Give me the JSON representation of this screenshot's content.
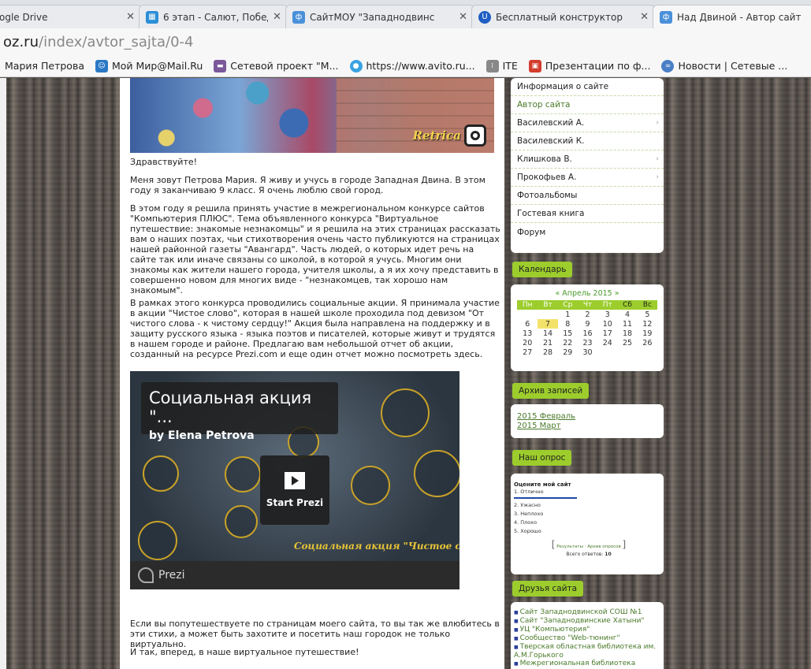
{
  "tabs": [
    {
      "label": "ogle Drive",
      "icon": "google-drive-icon",
      "color": "#d9d9d9"
    },
    {
      "label": "6 этап - Салют, Победа!",
      "icon": "calendar-icon",
      "color": "#2a8ed6"
    },
    {
      "label": "СайтМОУ \"Западнодвинс",
      "icon": "ucoz-icon",
      "color": "#4a90d9"
    },
    {
      "label": "Бесплатный конструктор",
      "icon": "ucoz-u-icon",
      "color": "#1f5fc4"
    },
    {
      "label": "Над Двиной - Автор сайт",
      "icon": "ucoz-icon",
      "color": "#4a90d9"
    }
  ],
  "address": {
    "host": "oz.ru",
    "path": "/index/avtor_sajta/0-4"
  },
  "bookmarks": [
    {
      "label": "Мария Петрова",
      "icon": "",
      "color": "#ffffff"
    },
    {
      "label": "Мой Мир@Mail.Ru",
      "icon": "mailru-icon",
      "color": "#2b78c5"
    },
    {
      "label": "Сетевой проект \"М...",
      "icon": "computer-icon",
      "color": "#7a5a9a"
    },
    {
      "label": "https://www.avito.ru...",
      "icon": "avito-icon",
      "color": "#3aa2e0"
    },
    {
      "label": "ITE",
      "icon": "ite-icon",
      "color": "#888888"
    },
    {
      "label": "Презентации по ф...",
      "icon": "presentation-icon",
      "color": "#d33d2e"
    },
    {
      "label": "Новости | Сетевые ...",
      "icon": "link-icon",
      "color": "#4a7fc6"
    }
  ],
  "content": {
    "greeting": "Здравствуйте!",
    "p1": "Меня зовут Петрова Мария. Я живу и учусь в городе Западная Двина. В этом году я заканчиваю 9 класс. Я очень люблю свой город.",
    "p2": "В этом году я решила принять участие в межрегиональном конкурсе сайтов \"Компьютерия ПЛЮС\". Тема объявленного конкурса \"Виртуальное путешествие: знакомые незнакомцы\" и я решила на этих страницах рассказать вам о наших поэтах, чьи стихотворения очень часто публикуются на страницах нашей районной газеты \"Авангард\". Часть людей, о которых идет речь на сайте так или иначе связаны со школой, в которой я учусь. Многим они знакомы как жители нашего города, учителя школы, а я их хочу представить в совершенно новом для многих виде - \"незнакомцев, так хорошо нам знакомым\".",
    "p3": "В рамках этого конкурса проводились социальные акции. Я принимала участие в акции \"Чистое слово\", которая в нашей школе проходила под девизом \"От чистого слова - к чистому сердцу!\" Акция была направлена на поддержку и в защиту русского языка - языка поэтов и писателей, которые живут и трудятся в нашем городе и районе. Предлагаю вам небольшой отчет об акции, созданный на ресурсе Prezi.com и еще один отчет можно посмотреть здесь.",
    "p4": "Если вы попутешествуете по страницам моего сайта, то вы так же влюбитесь в эти стихи, а может быть захотите и посетить наш городок не только виртуально.",
    "p5": "И так, вперед, в наше виртуальное путешествие!"
  },
  "prezi": {
    "title": "Социальная акция \"...",
    "author": "by Elena Petrova",
    "start": "Start Prezi",
    "caption": "Социальная акция \"Чистое сл",
    "brand": "Prezi"
  },
  "banner": {
    "logo_text": "Retrica"
  },
  "sidebar": {
    "menu": [
      {
        "label": "Информация о сайте",
        "arrow": false,
        "link": false
      },
      {
        "label": "Автор сайта",
        "arrow": false,
        "link": true
      },
      {
        "label": "Василевский А.",
        "arrow": true,
        "link": false
      },
      {
        "label": "Василевский К.",
        "arrow": false,
        "link": false
      },
      {
        "label": "Клишкова В.",
        "arrow": true,
        "link": false
      },
      {
        "label": "Прокофьев А.",
        "arrow": true,
        "link": false
      },
      {
        "label": "Фотоальбомы",
        "arrow": false,
        "link": false
      },
      {
        "label": "Гостевая книга",
        "arrow": false,
        "link": false
      },
      {
        "label": "Форум",
        "arrow": false,
        "link": false
      }
    ],
    "calendar_title": "Календарь",
    "calendar": {
      "month": "«   Апрель 2015   »",
      "days": [
        "Пн",
        "Вт",
        "Ср",
        "Чт",
        "Пт",
        "Сб",
        "Вс"
      ],
      "weeks": [
        [
          "",
          "",
          "1",
          "2",
          "3",
          "4",
          "5"
        ],
        [
          "6",
          "7",
          "8",
          "9",
          "10",
          "11",
          "12"
        ],
        [
          "13",
          "14",
          "15",
          "16",
          "17",
          "18",
          "19"
        ],
        [
          "20",
          "21",
          "22",
          "23",
          "24",
          "25",
          "26"
        ],
        [
          "27",
          "28",
          "29",
          "30",
          "",
          "",
          ""
        ]
      ],
      "today": "7"
    },
    "archive_title": "Архив записей",
    "archive": [
      "2015 Февраль",
      "2015 Март"
    ],
    "poll_title": "Наш опрос",
    "poll": {
      "question": "Оцените мой сайт",
      "options": [
        "1. Отлично",
        "2. Ужасно",
        "3. Неплохо",
        "4. Плохо",
        "5. Хорошо"
      ],
      "results": "Результаты",
      "archive": "Архив опросов",
      "total_label": "Всего ответов:",
      "total": "10"
    },
    "friends_title": "Друзья сайта",
    "friends": [
      "Сайт Западнодвинской СОШ №1",
      "Сайт \"Западнодвинские Хатыни\"",
      "УЦ \"Компьютерия\"",
      "Сообщество \"Web-тюнинг\"",
      "Тверская областная библиотека им. А.М.Горького",
      "Межрегиональная библиотека"
    ]
  }
}
